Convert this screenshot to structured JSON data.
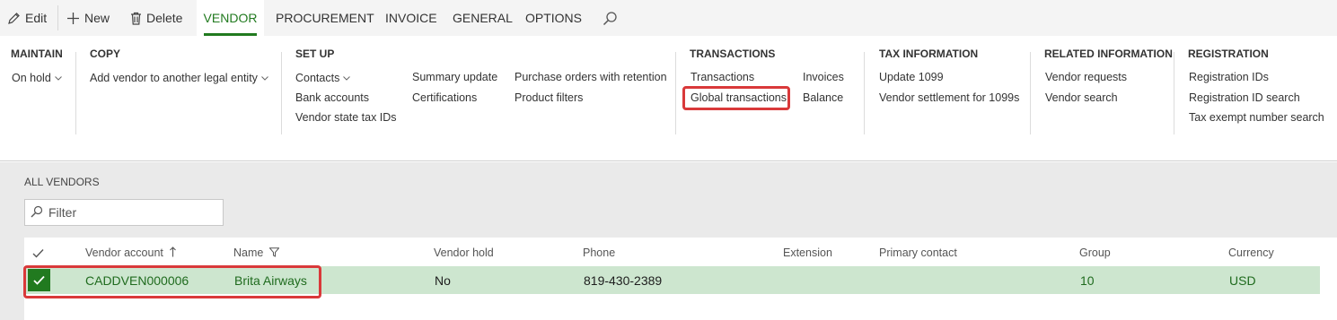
{
  "toolbar": {
    "edit_label": "Edit",
    "new_label": "New",
    "delete_label": "Delete",
    "tabs": [
      {
        "label": "VENDOR",
        "active": true
      },
      {
        "label": "PROCUREMENT",
        "active": false
      },
      {
        "label": "INVOICE",
        "active": false
      },
      {
        "label": "GENERAL",
        "active": false
      },
      {
        "label": "OPTIONS",
        "active": false
      }
    ],
    "icons": {
      "edit": "pencil-icon",
      "new": "plus-icon",
      "delete": "trash-icon",
      "search": "search-icon"
    }
  },
  "ribbon": {
    "maintain": {
      "title": "MAINTAIN",
      "on_hold": "On hold"
    },
    "copy": {
      "title": "COPY",
      "add_vendor": "Add vendor to another legal entity"
    },
    "setup": {
      "title": "SET UP",
      "contacts": "Contacts",
      "bank_accounts": "Bank accounts",
      "vendor_state_tax_ids": "Vendor state tax IDs",
      "summary_update": "Summary update",
      "certifications": "Certifications",
      "purchase_orders_retention": "Purchase orders with retention",
      "product_filters": "Product filters"
    },
    "transactions": {
      "title": "TRANSACTIONS",
      "transactions": "Transactions",
      "global_transactions": "Global transactions",
      "invoices": "Invoices",
      "balance": "Balance"
    },
    "tax_information": {
      "title": "TAX INFORMATION",
      "update_1099": "Update 1099",
      "vendor_settlement": "Vendor settlement for 1099s"
    },
    "related_information": {
      "title": "RELATED INFORMATION",
      "vendor_requests": "Vendor requests",
      "vendor_search": "Vendor search"
    },
    "registration": {
      "title": "REGISTRATION",
      "registration_ids": "Registration IDs",
      "registration_id_search": "Registration ID search",
      "tax_exempt_search": "Tax exempt number search"
    }
  },
  "content": {
    "section_title": "ALL VENDORS",
    "filter_placeholder": "Filter",
    "columns": {
      "vendor_account": "Vendor account",
      "name": "Name",
      "vendor_hold": "Vendor hold",
      "phone": "Phone",
      "extension": "Extension",
      "primary_contact": "Primary contact",
      "group": "Group",
      "currency": "Currency"
    },
    "rows": [
      {
        "vendor_account": "CADDVEN000006",
        "name": "Brita Airways",
        "vendor_hold": "No",
        "phone": "819-430-2389",
        "extension": "",
        "primary_contact": "",
        "group": "10",
        "currency": "USD",
        "selected": true
      }
    ]
  },
  "colors": {
    "accent_green": "#217a1f",
    "selected_row": "#cde6cf",
    "highlight_red": "#d9393a"
  }
}
